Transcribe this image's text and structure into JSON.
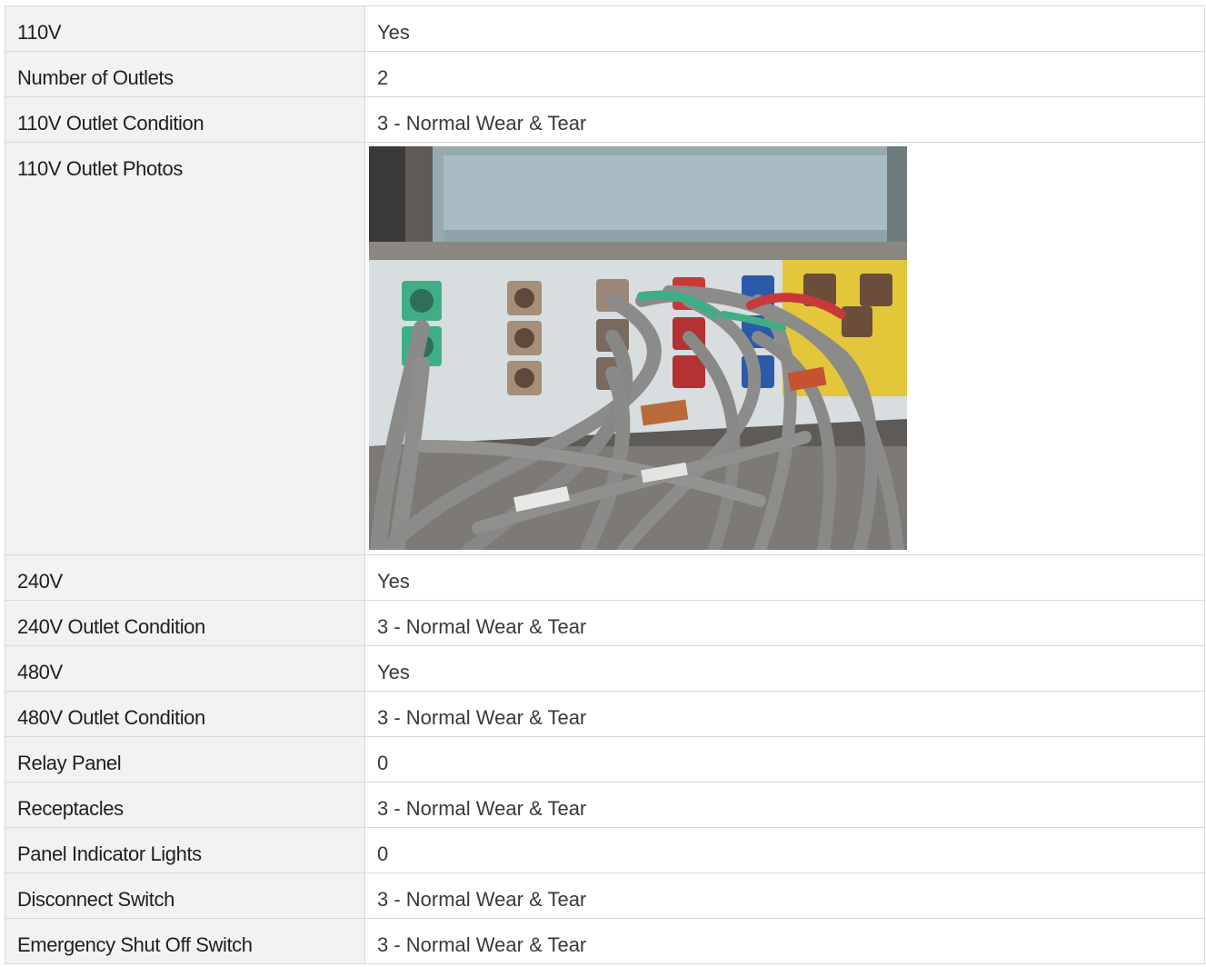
{
  "rows": [
    {
      "label": "110V",
      "value": "Yes"
    },
    {
      "label": "Number of Outlets",
      "value": "2"
    },
    {
      "label": "110V Outlet Condition",
      "value": "3 - Normal Wear & Tear"
    },
    {
      "label": "110V Outlet Photos",
      "photo": "outlet-panel-photo"
    },
    {
      "label": "240V",
      "value": "Yes"
    },
    {
      "label": "240V Outlet Condition",
      "value": "3 - Normal Wear & Tear"
    },
    {
      "label": "480V",
      "value": "Yes"
    },
    {
      "label": "480V Outlet Condition",
      "value": "3 - Normal Wear & Tear"
    },
    {
      "label": "Relay Panel",
      "value": "0"
    },
    {
      "label": "Receptacles",
      "value": "3 - Normal Wear & Tear"
    },
    {
      "label": "Panel Indicator Lights",
      "value": "0"
    },
    {
      "label": "Disconnect Switch",
      "value": "3 - Normal Wear & Tear"
    },
    {
      "label": "Emergency Shut Off Switch",
      "value": "3 - Normal Wear & Tear"
    }
  ],
  "colors": {
    "label_bg": "#f2f2f2",
    "border": "#d9d9d9",
    "panel_gray": "#9fb0b5",
    "cable_gray": "#8a8a88",
    "accent_green": "#3fae86",
    "accent_red": "#c8393a",
    "accent_blue": "#2a5aa8",
    "accent_yellow": "#e6c72a"
  }
}
